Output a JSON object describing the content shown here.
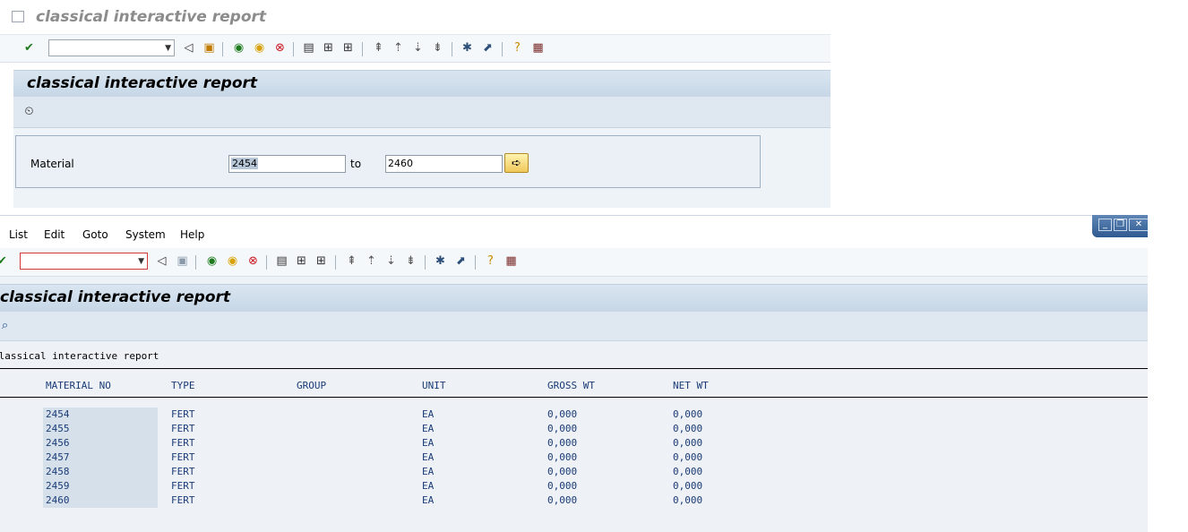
{
  "selection_window": {
    "title": "classical interactive report",
    "header": "classical interactive report",
    "field_label": "Material",
    "low_value": "2454",
    "to_label": "to",
    "high_value": "2460"
  },
  "list_window": {
    "menu": [
      "List",
      "Edit",
      "Goto",
      "System",
      "Help"
    ],
    "header": "classical interactive report",
    "list_title": "classical interactive report",
    "columns": [
      "MATERIAL NO",
      "TYPE",
      "GROUP",
      "UNIT",
      "GROSS WT",
      "NET WT"
    ],
    "rows": [
      {
        "material": "2454",
        "type": "FERT",
        "group": "",
        "unit": "EA",
        "gross": "0,000",
        "net": "0,000"
      },
      {
        "material": "2455",
        "type": "FERT",
        "group": "",
        "unit": "EA",
        "gross": "0,000",
        "net": "0,000"
      },
      {
        "material": "2456",
        "type": "FERT",
        "group": "",
        "unit": "EA",
        "gross": "0,000",
        "net": "0,000"
      },
      {
        "material": "2457",
        "type": "FERT",
        "group": "",
        "unit": "EA",
        "gross": "0,000",
        "net": "0,000"
      },
      {
        "material": "2458",
        "type": "FERT",
        "group": "",
        "unit": "EA",
        "gross": "0,000",
        "net": "0,000"
      },
      {
        "material": "2459",
        "type": "FERT",
        "group": "",
        "unit": "EA",
        "gross": "0,000",
        "net": "0,000"
      },
      {
        "material": "2460",
        "type": "FERT",
        "group": "",
        "unit": "EA",
        "gross": "0,000",
        "net": "0,000"
      }
    ]
  },
  "toolbar_icons": [
    "enter-icon",
    "back-icon",
    "save-icon",
    "green-back-icon",
    "exit-icon",
    "cancel-icon",
    "print-icon",
    "find-icon",
    "find-next-icon",
    "first-page-icon",
    "previous-page-icon",
    "next-page-icon",
    "last-page-icon",
    "new-session-icon",
    "shortcut-icon",
    "help-icon",
    "layout-icon"
  ],
  "colors": {
    "header_bg": "#c6d6e6",
    "list_text": "#1a3b78",
    "key_bg": "#d6e0eb"
  }
}
